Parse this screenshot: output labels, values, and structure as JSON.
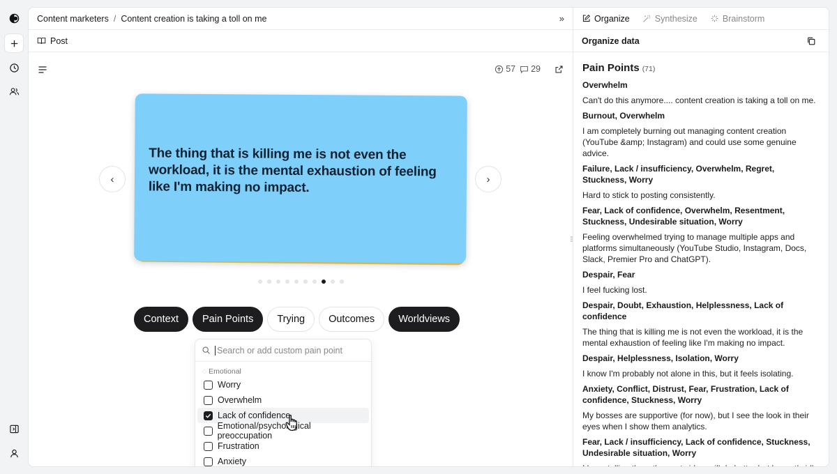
{
  "breadcrumb": [
    "Content marketers",
    "Content creation is taking a toll on me"
  ],
  "subbar": {
    "label": "Post"
  },
  "stats": {
    "upvotes": "57",
    "comments": "29"
  },
  "card": {
    "text": "The thing that is killing me is not even the workload, it is the mental exhaustion of feeling like I'm making no impact."
  },
  "carousel": {
    "total": 10,
    "active_index": 7
  },
  "chips": [
    {
      "label": "Context",
      "active": true
    },
    {
      "label": "Pain Points",
      "active": true
    },
    {
      "label": "Trying",
      "active": false
    },
    {
      "label": "Outcomes",
      "active": false
    },
    {
      "label": "Worldviews",
      "active": true
    }
  ],
  "dropdown": {
    "placeholder": "Search or add custom pain point",
    "group": "Emotional",
    "items": [
      {
        "label": "Worry",
        "checked": false
      },
      {
        "label": "Overwhelm",
        "checked": false
      },
      {
        "label": "Lack of confidence",
        "checked": true
      },
      {
        "label": "Emotional/psychological preoccupation",
        "checked": false
      },
      {
        "label": "Frustration",
        "checked": false
      },
      {
        "label": "Anxiety",
        "checked": false
      }
    ]
  },
  "right": {
    "tabs": [
      "Organize",
      "Synthesize",
      "Brainstorm"
    ],
    "active_tab": "Organize",
    "header": "Organize data",
    "title": "Pain Points",
    "count": "(71)",
    "entries": [
      {
        "tags": "Overwhelm",
        "text": "Can't do this anymore.... content creation is taking a toll on me."
      },
      {
        "tags": "Burnout, Overwhelm",
        "text": "I am completely burning out managing content creation (YouTube &amp; Instagram) and could use some genuine advice."
      },
      {
        "tags": "Failure, Lack / insufficiency, Overwhelm, Regret, Stuckness, Worry",
        "text": "Hard to stick to posting consistently."
      },
      {
        "tags": "Fear, Lack of confidence, Overwhelm, Resentment, Stuckness, Undesirable situation, Worry",
        "text": "Feeling overwhelmed trying to manage multiple apps and platforms simultaneously (YouTube Studio, Instagram, Docs, Slack, Premier Pro and ChatGPT)."
      },
      {
        "tags": "Despair, Fear",
        "text": "I feel fucking lost."
      },
      {
        "tags": "Despair, Doubt, Exhaustion, Helplessness, Lack of confidence",
        "text": "The thing that is killing me is not even the workload, it is the mental exhaustion of feeling like I'm making no impact."
      },
      {
        "tags": "Despair, Helplessness, Isolation, Worry",
        "text": "I know I'm probably not alone in this, but it feels isolating."
      },
      {
        "tags": "Anxiety, Conflict, Distrust, Fear, Frustration, Lack of confidence, Stuckness, Worry",
        "text": "My bosses are supportive (for now), but I see the look in their eyes when I show them analytics."
      },
      {
        "tags": "Fear, Lack / insufficiency, Lack of confidence, Stuckness, Undesirable situation, Worry",
        "text": "I keep telling them the next vidwo will do better but honestly idk anymore."
      }
    ]
  },
  "colors": {
    "card": "#7ecffa",
    "card_back": "#f7d04a",
    "chip_dark": "#1d1d1f"
  },
  "icons": [
    "app-logo-icon",
    "plus-icon",
    "clock-icon",
    "users-icon",
    "sidebar-toggle-icon",
    "user-icon",
    "book-icon",
    "menu-icon",
    "upvote-icon",
    "comment-icon",
    "external-link-icon",
    "search-icon",
    "copy-icon",
    "edit-icon",
    "sparkle-icon",
    "brainstorm-icon"
  ]
}
